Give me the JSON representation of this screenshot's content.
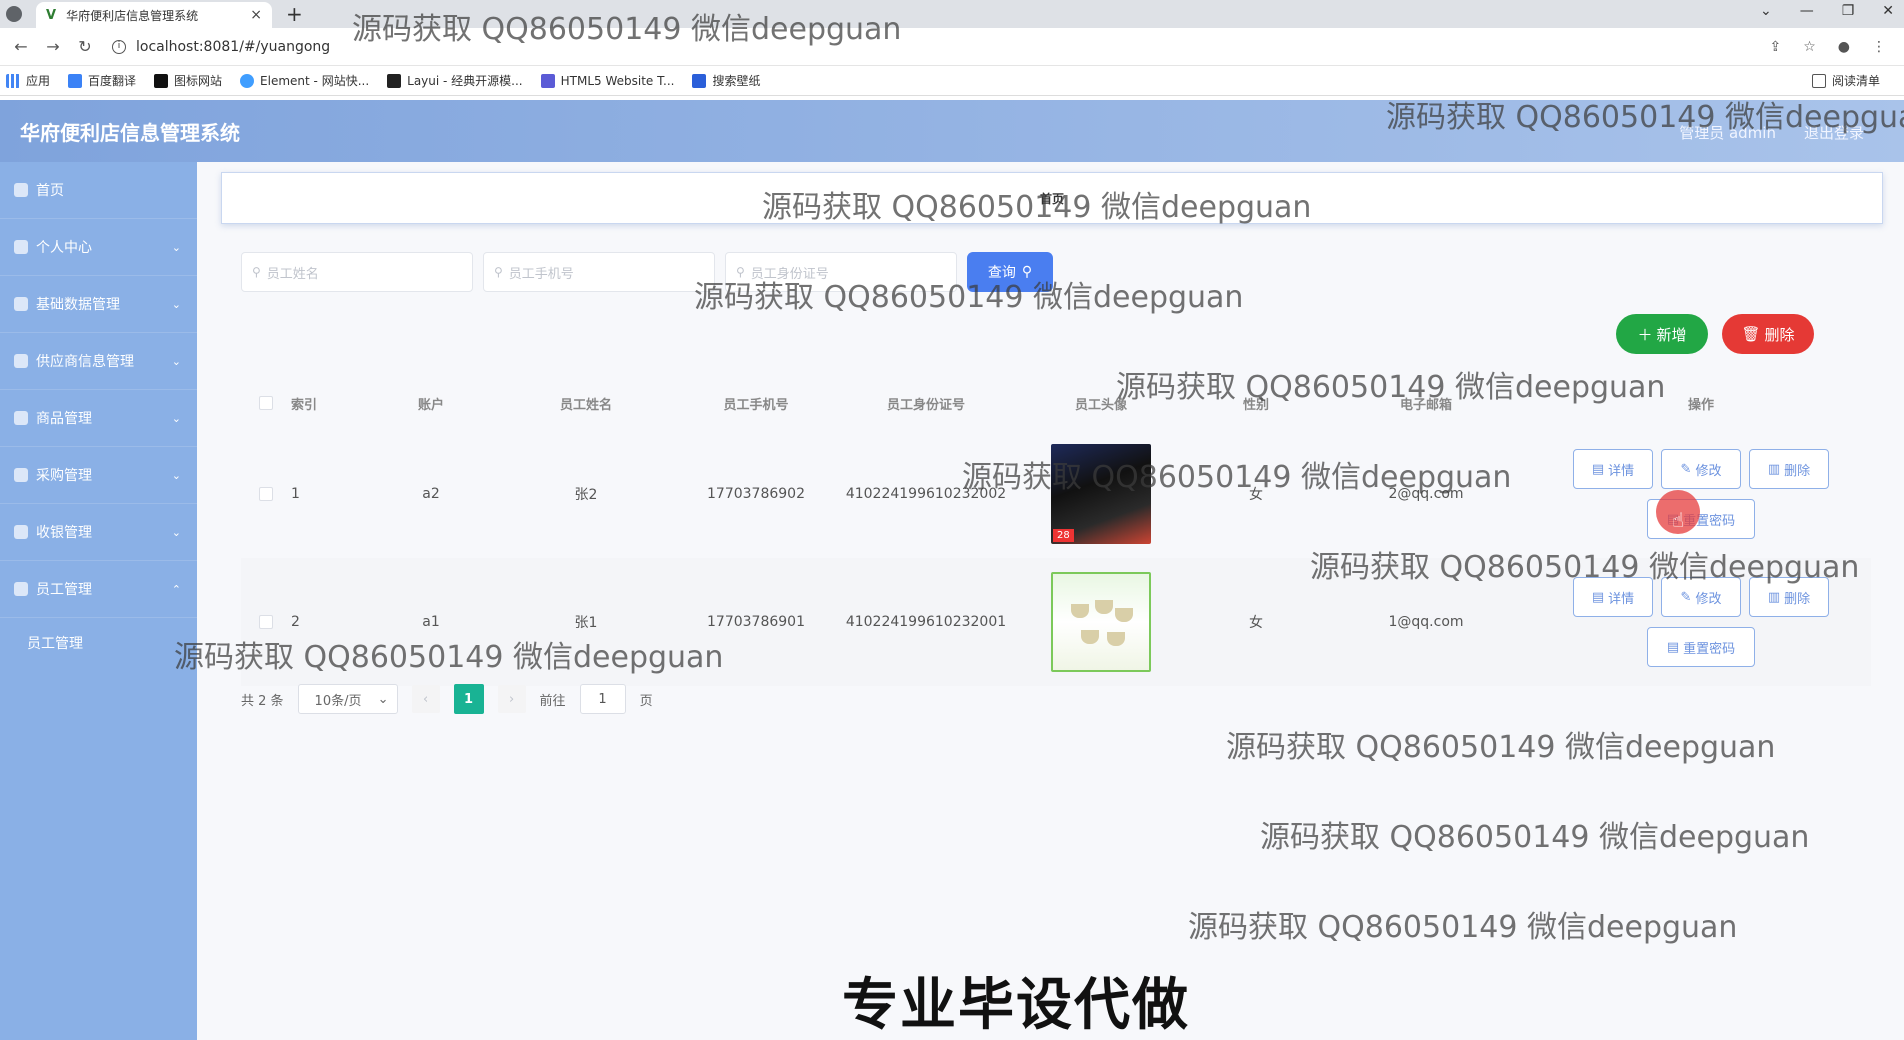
{
  "browser": {
    "tab_title": "华府便利店信息管理系统",
    "tab_close": "×",
    "new_tab": "+",
    "url": "localhost:8081/#/yuangong",
    "bookmarks": [
      "应用",
      "百度翻译",
      "图标网站",
      "Element - 网站快...",
      "Layui - 经典开源模...",
      "HTML5 Website T...",
      "搜索壁纸"
    ],
    "reading_list": "阅读清单"
  },
  "header": {
    "title": "华府便利店信息管理系统",
    "user": "管理员 admin",
    "logout": "退出登录"
  },
  "sidebar": {
    "items": [
      {
        "label": "首页"
      },
      {
        "label": "个人中心"
      },
      {
        "label": "基础数据管理"
      },
      {
        "label": "供应商信息管理"
      },
      {
        "label": "商品管理"
      },
      {
        "label": "采购管理"
      },
      {
        "label": "收银管理"
      },
      {
        "label": "员工管理"
      }
    ],
    "sub_item": "员工管理"
  },
  "breadcrumb": "首页",
  "search": {
    "name_placeholder": "员工姓名",
    "phone_placeholder": "员工手机号",
    "idcard_placeholder": "员工身份证号",
    "query_label": "查询"
  },
  "actions": {
    "add_label": "新增",
    "delete_label": "删除"
  },
  "table": {
    "headers": [
      "索引",
      "账户",
      "员工姓名",
      "员工手机号",
      "员工身份证号",
      "员工头像",
      "性别",
      "电子邮箱",
      "操作"
    ],
    "rows": [
      {
        "index": "1",
        "account": "a2",
        "name": "张2",
        "phone": "17703786902",
        "idcard": "410224199610232002",
        "photo_badge": "28",
        "sex": "女",
        "email": "2@qq.com"
      },
      {
        "index": "2",
        "account": "a1",
        "name": "张1",
        "phone": "17703786901",
        "idcard": "410224199610232001",
        "sex": "女",
        "email": "1@qq.com"
      }
    ],
    "op_detail": "详情",
    "op_edit": "修改",
    "op_delete": "删除",
    "op_reset": "重置密码"
  },
  "pager": {
    "total": "共 2 条",
    "page_size": "10条/页",
    "current": "1",
    "goto_prefix": "前往",
    "goto_value": "1",
    "goto_suffix": "页"
  },
  "watermark_text": "源码获取 QQ86050149 微信deepguan",
  "banner": "专业毕设代做"
}
